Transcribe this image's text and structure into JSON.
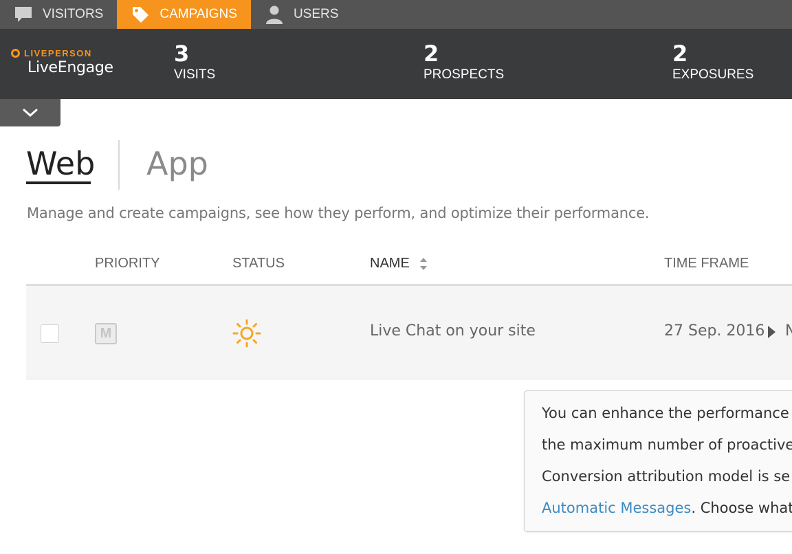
{
  "nav": {
    "tabs": [
      {
        "label": "VISITORS",
        "icon": "chat-bubble-icon"
      },
      {
        "label": "CAMPAIGNS",
        "icon": "tag-icon",
        "active": true
      },
      {
        "label": "USERS",
        "icon": "user-icon"
      }
    ]
  },
  "header": {
    "logo_top": "LIVEPERSON",
    "logo_bottom": "LiveEngage",
    "stats": [
      {
        "value": "3",
        "label": "VISITS"
      },
      {
        "value": "2",
        "label": "PROSPECTS"
      },
      {
        "value": "2",
        "label": "EXPOSURES"
      }
    ]
  },
  "tabs": {
    "web": "Web",
    "app": "App"
  },
  "description": "Manage and create campaigns, see how they perform, and optimize their performance.",
  "table": {
    "headers": {
      "priority": "PRIORITY",
      "status": "STATUS",
      "name": "NAME",
      "timeframe": "TIME FRAME"
    },
    "rows": [
      {
        "priority_badge": "M",
        "status_icon": "sun-icon",
        "name": "Live Chat on your site",
        "timeframe": "27 Sep. 2016",
        "timeframe_cut": "N"
      }
    ]
  },
  "tooltip": {
    "line1": "You can enhance the performance",
    "line2": "the maximum number of proactive",
    "line3": "Conversion attribution model is se",
    "link": "Automatic Messages",
    "line4_rest": ". Choose what"
  },
  "colors": {
    "accent": "#f7941d",
    "nav_bg": "#545454",
    "header_bg": "#3a3b3d",
    "link": "#3d8bc2"
  }
}
